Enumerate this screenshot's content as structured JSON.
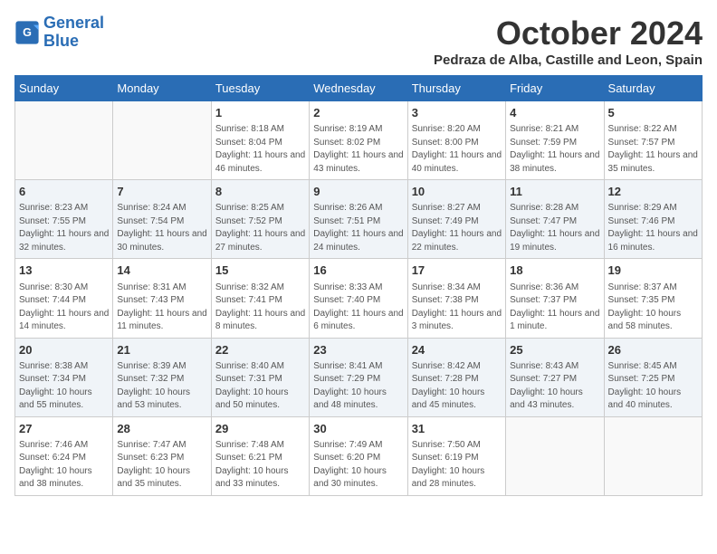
{
  "logo": {
    "line1": "General",
    "line2": "Blue"
  },
  "title": "October 2024",
  "subtitle": "Pedraza de Alba, Castille and Leon, Spain",
  "weekdays": [
    "Sunday",
    "Monday",
    "Tuesday",
    "Wednesday",
    "Thursday",
    "Friday",
    "Saturday"
  ],
  "weeks": [
    [
      {
        "day": "",
        "info": ""
      },
      {
        "day": "",
        "info": ""
      },
      {
        "day": "1",
        "info": "Sunrise: 8:18 AM\nSunset: 8:04 PM\nDaylight: 11 hours and 46 minutes."
      },
      {
        "day": "2",
        "info": "Sunrise: 8:19 AM\nSunset: 8:02 PM\nDaylight: 11 hours and 43 minutes."
      },
      {
        "day": "3",
        "info": "Sunrise: 8:20 AM\nSunset: 8:00 PM\nDaylight: 11 hours and 40 minutes."
      },
      {
        "day": "4",
        "info": "Sunrise: 8:21 AM\nSunset: 7:59 PM\nDaylight: 11 hours and 38 minutes."
      },
      {
        "day": "5",
        "info": "Sunrise: 8:22 AM\nSunset: 7:57 PM\nDaylight: 11 hours and 35 minutes."
      }
    ],
    [
      {
        "day": "6",
        "info": "Sunrise: 8:23 AM\nSunset: 7:55 PM\nDaylight: 11 hours and 32 minutes."
      },
      {
        "day": "7",
        "info": "Sunrise: 8:24 AM\nSunset: 7:54 PM\nDaylight: 11 hours and 30 minutes."
      },
      {
        "day": "8",
        "info": "Sunrise: 8:25 AM\nSunset: 7:52 PM\nDaylight: 11 hours and 27 minutes."
      },
      {
        "day": "9",
        "info": "Sunrise: 8:26 AM\nSunset: 7:51 PM\nDaylight: 11 hours and 24 minutes."
      },
      {
        "day": "10",
        "info": "Sunrise: 8:27 AM\nSunset: 7:49 PM\nDaylight: 11 hours and 22 minutes."
      },
      {
        "day": "11",
        "info": "Sunrise: 8:28 AM\nSunset: 7:47 PM\nDaylight: 11 hours and 19 minutes."
      },
      {
        "day": "12",
        "info": "Sunrise: 8:29 AM\nSunset: 7:46 PM\nDaylight: 11 hours and 16 minutes."
      }
    ],
    [
      {
        "day": "13",
        "info": "Sunrise: 8:30 AM\nSunset: 7:44 PM\nDaylight: 11 hours and 14 minutes."
      },
      {
        "day": "14",
        "info": "Sunrise: 8:31 AM\nSunset: 7:43 PM\nDaylight: 11 hours and 11 minutes."
      },
      {
        "day": "15",
        "info": "Sunrise: 8:32 AM\nSunset: 7:41 PM\nDaylight: 11 hours and 8 minutes."
      },
      {
        "day": "16",
        "info": "Sunrise: 8:33 AM\nSunset: 7:40 PM\nDaylight: 11 hours and 6 minutes."
      },
      {
        "day": "17",
        "info": "Sunrise: 8:34 AM\nSunset: 7:38 PM\nDaylight: 11 hours and 3 minutes."
      },
      {
        "day": "18",
        "info": "Sunrise: 8:36 AM\nSunset: 7:37 PM\nDaylight: 11 hours and 1 minute."
      },
      {
        "day": "19",
        "info": "Sunrise: 8:37 AM\nSunset: 7:35 PM\nDaylight: 10 hours and 58 minutes."
      }
    ],
    [
      {
        "day": "20",
        "info": "Sunrise: 8:38 AM\nSunset: 7:34 PM\nDaylight: 10 hours and 55 minutes."
      },
      {
        "day": "21",
        "info": "Sunrise: 8:39 AM\nSunset: 7:32 PM\nDaylight: 10 hours and 53 minutes."
      },
      {
        "day": "22",
        "info": "Sunrise: 8:40 AM\nSunset: 7:31 PM\nDaylight: 10 hours and 50 minutes."
      },
      {
        "day": "23",
        "info": "Sunrise: 8:41 AM\nSunset: 7:29 PM\nDaylight: 10 hours and 48 minutes."
      },
      {
        "day": "24",
        "info": "Sunrise: 8:42 AM\nSunset: 7:28 PM\nDaylight: 10 hours and 45 minutes."
      },
      {
        "day": "25",
        "info": "Sunrise: 8:43 AM\nSunset: 7:27 PM\nDaylight: 10 hours and 43 minutes."
      },
      {
        "day": "26",
        "info": "Sunrise: 8:45 AM\nSunset: 7:25 PM\nDaylight: 10 hours and 40 minutes."
      }
    ],
    [
      {
        "day": "27",
        "info": "Sunrise: 7:46 AM\nSunset: 6:24 PM\nDaylight: 10 hours and 38 minutes."
      },
      {
        "day": "28",
        "info": "Sunrise: 7:47 AM\nSunset: 6:23 PM\nDaylight: 10 hours and 35 minutes."
      },
      {
        "day": "29",
        "info": "Sunrise: 7:48 AM\nSunset: 6:21 PM\nDaylight: 10 hours and 33 minutes."
      },
      {
        "day": "30",
        "info": "Sunrise: 7:49 AM\nSunset: 6:20 PM\nDaylight: 10 hours and 30 minutes."
      },
      {
        "day": "31",
        "info": "Sunrise: 7:50 AM\nSunset: 6:19 PM\nDaylight: 10 hours and 28 minutes."
      },
      {
        "day": "",
        "info": ""
      },
      {
        "day": "",
        "info": ""
      }
    ]
  ]
}
